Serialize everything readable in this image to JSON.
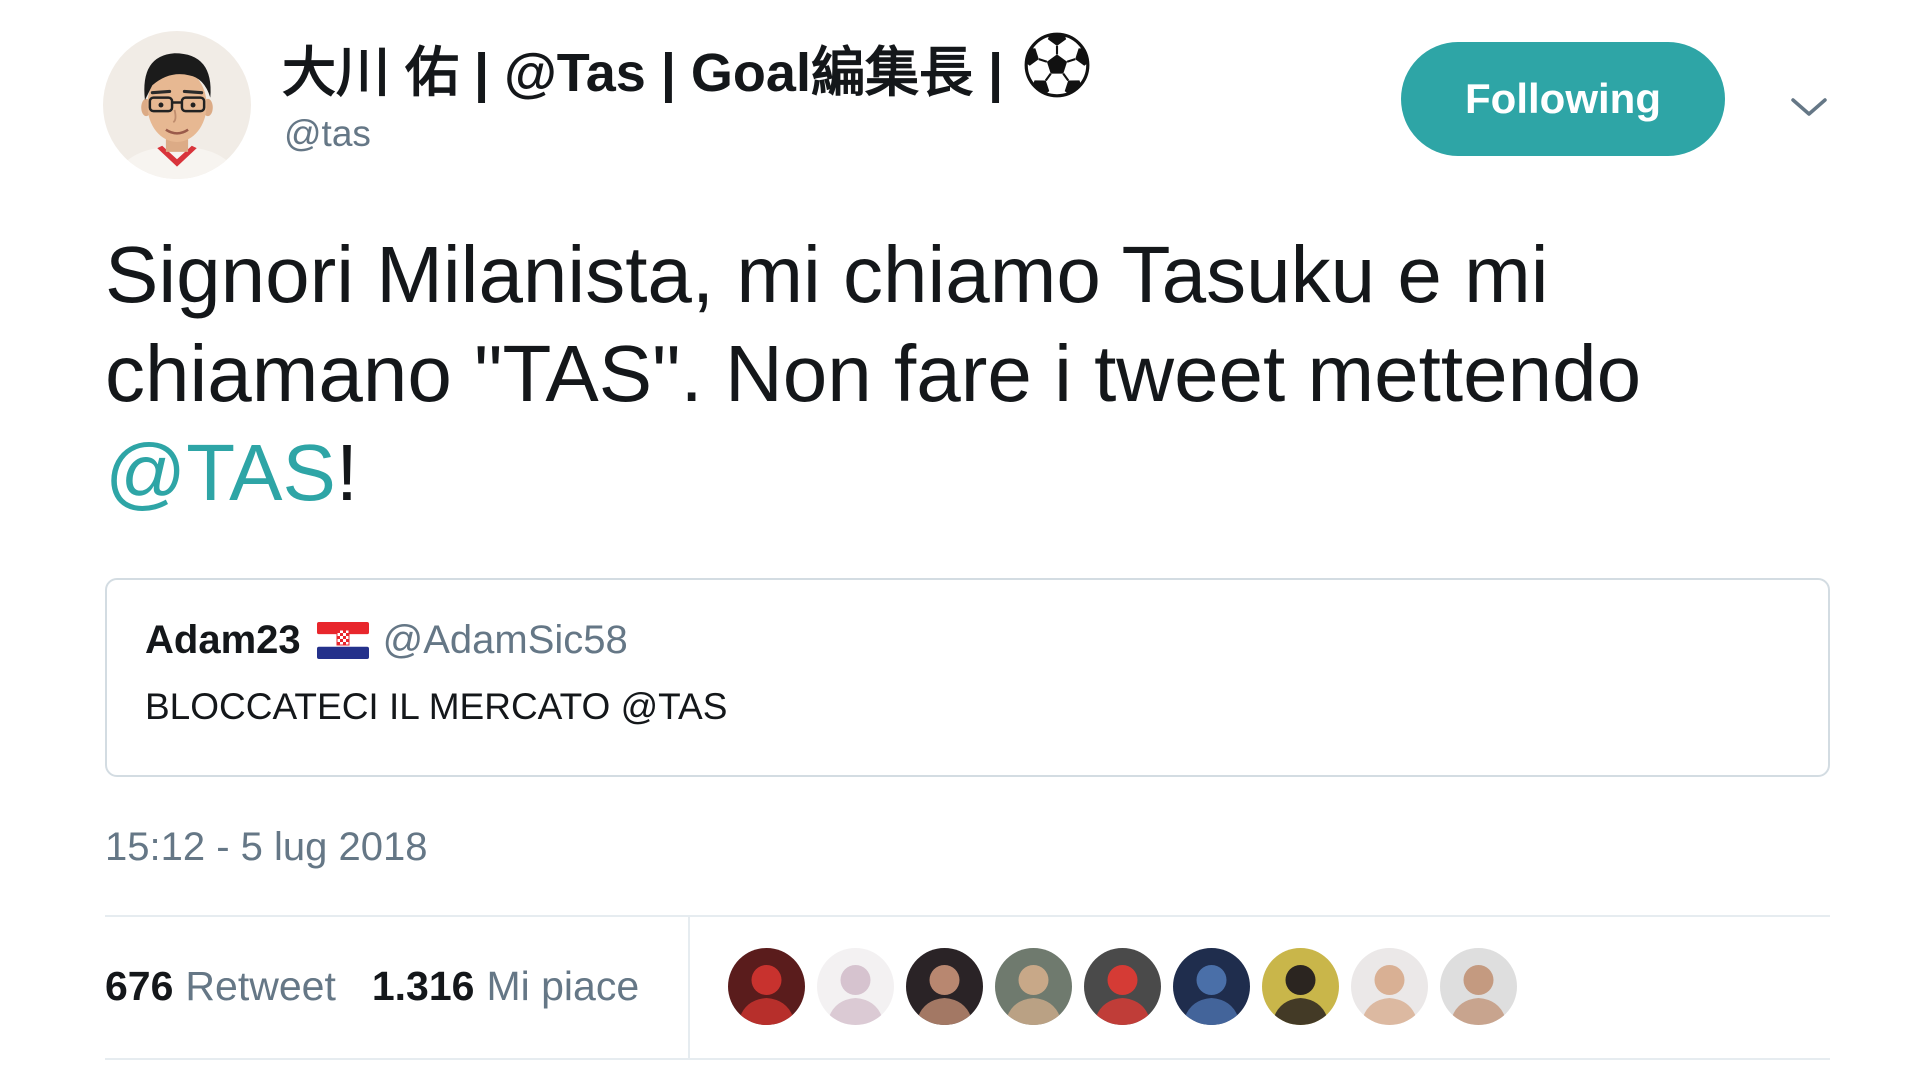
{
  "tweet": {
    "author": {
      "display_name": "大川 佑 | @Tas | Goal編集長 |",
      "name_emoji_icon": "soccer-ball-icon",
      "handle": "@tas",
      "avatar_icon": "profile-photo"
    },
    "follow_button": {
      "label": "Following"
    },
    "menu_icon": "chevron-down-icon",
    "text": {
      "before_mention": "Signori Milanista, mi chiamo Tasuku e mi chiamano \"TAS\". Non fare i tweet mettendo ",
      "mention": "@TAS",
      "after_mention": "!"
    },
    "quoted_tweet": {
      "display_name": "Adam23",
      "flag_icon": "croatia-flag-icon",
      "handle": "@AdamSic58",
      "text": "BLOCCATECI IL MERCATO @TAS"
    },
    "timestamp": "15:12 - 5 lug 2018",
    "stats": {
      "retweets_count": "676",
      "retweets_label": "Retweet",
      "likes_count": "1.316",
      "likes_label": "Mi piace"
    },
    "liker_avatars": [
      {
        "bg": "#5a1c1c",
        "fg": "#c8322e"
      },
      {
        "bg": "#f3f1f2",
        "fg": "#d6c3cf"
      },
      {
        "bg": "#2a2326",
        "fg": "#b88770"
      },
      {
        "bg": "#6f7a6e",
        "fg": "#c8a888"
      },
      {
        "bg": "#4a4a4a",
        "fg": "#d53b35"
      },
      {
        "bg": "#1f2d4d",
        "fg": "#4a6fa8"
      },
      {
        "bg": "#c9b64a",
        "fg": "#2b2520"
      },
      {
        "bg": "#ebe8e8",
        "fg": "#d9b094"
      },
      {
        "bg": "#dedede",
        "fg": "#c49a80"
      }
    ]
  },
  "colors": {
    "accent": "#2ea5a6",
    "text": "#14171a",
    "secondary_text": "#657786",
    "divider": "#e6ecf0"
  }
}
